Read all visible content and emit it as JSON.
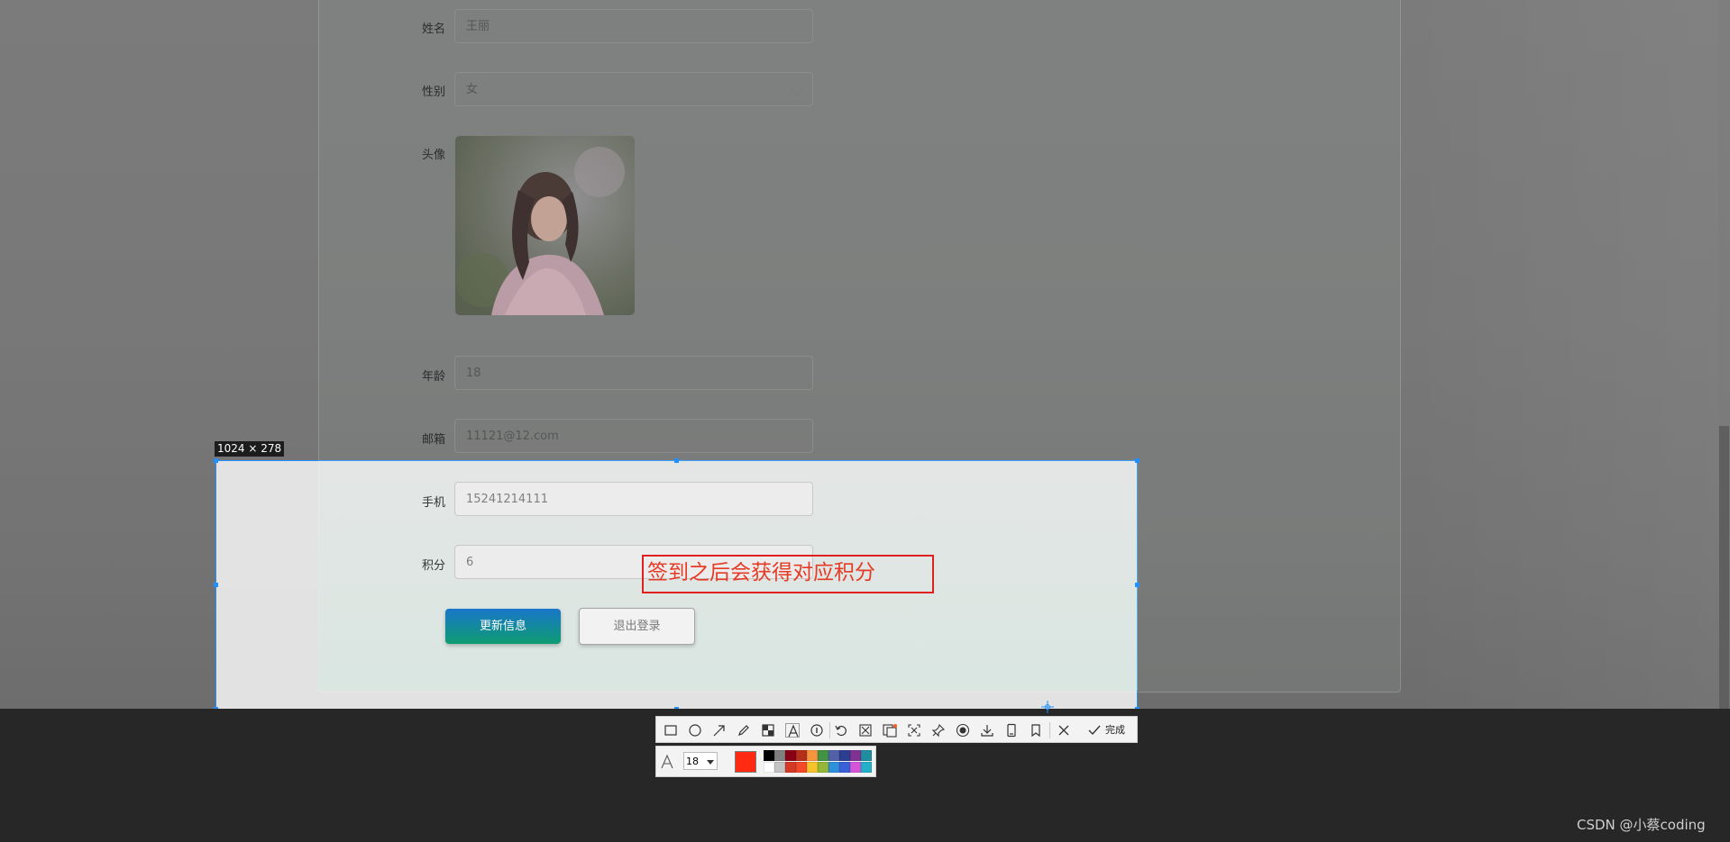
{
  "form": {
    "name_label": "姓名",
    "name_value": "王丽",
    "gender_label": "性别",
    "gender_value": "女",
    "avatar_label": "头像",
    "age_label": "年龄",
    "age_value": "18",
    "email_label": "邮箱",
    "email_value": "11121@12.com",
    "phone_label": "手机",
    "phone_value": "15241214111",
    "points_label": "积分",
    "points_value": "6",
    "update_button": "更新信息",
    "logout_button": "退出登录"
  },
  "screenshot_tool": {
    "size_label": "1024 × 278",
    "annotation_text": "签到之后会获得对应积分",
    "done_label": "完成",
    "font_size": "18",
    "current_color": "#ff2a12",
    "tools": [
      "rectangle-icon",
      "ellipse-icon",
      "arrow-icon",
      "pencil-icon",
      "mosaic-icon",
      "text-icon",
      "number-icon",
      "undo-icon",
      "scissors-icon",
      "ocr-icon",
      "scroll-capture-icon",
      "pin-icon",
      "record-icon",
      "download-icon",
      "phone-icon",
      "bookmark-icon",
      "close-icon",
      "check-icon"
    ],
    "palette_top": [
      "#000000",
      "#7f7f7f",
      "#880015",
      "#b5301a",
      "#f7943e",
      "#3f9342",
      "#5260a8",
      "#2b3e8f",
      "#7f3291",
      "#1f8fa0"
    ],
    "palette_bottom": [
      "#ffffff",
      "#c3c3c3",
      "#d53a26",
      "#f44a2c",
      "#f5c32b",
      "#94b738",
      "#2f8fd8",
      "#3a60d8",
      "#d455d8",
      "#24b0c8"
    ]
  },
  "watermark": "CSDN @小蔡coding"
}
